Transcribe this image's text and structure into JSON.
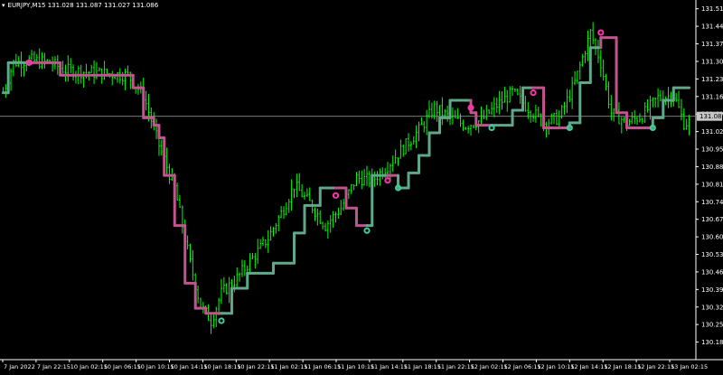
{
  "header": {
    "symbol_line": "EURJPY,M15  131.028 131.087 131.027 131.086"
  },
  "current_price_label": "131.086",
  "colors": {
    "background": "#000000",
    "bars": "#00ff00",
    "axis": "#ffffff",
    "text": "#ffffff",
    "trend_up": "#5fa88a",
    "trend_down": "#c2538f",
    "dot_up": "#3ccf9a",
    "dot_down": "#ff33aa",
    "bid_line": "#8c8c8c"
  },
  "chart_data": {
    "type": "candlestick",
    "symbol": "EURJPY",
    "timeframe": "M15",
    "ohlc_readout": {
      "open": 131.028,
      "high": 131.087,
      "low": 131.027,
      "close": 131.086
    },
    "ylim": [
      130.115,
      131.55
    ],
    "y_ticks": [
      "131.515",
      "131.445",
      "131.375",
      "131.305",
      "131.235",
      "131.165",
      "131.095",
      "131.025",
      "130.955",
      "130.885",
      "130.815",
      "130.745",
      "130.675",
      "130.605",
      "130.535",
      "130.465",
      "130.395",
      "130.325",
      "130.255",
      "130.185"
    ],
    "x_ticks": [
      "7 Jan 2022",
      "7 Jan 22:15",
      "10 Jan 02:15",
      "10 Jan 06:15",
      "10 Jan 10:15",
      "10 Jan 14:15",
      "10 Jan 18:15",
      "10 Jan 22:15",
      "11 Jan 02:15",
      "11 Jan 06:15",
      "11 Jan 10:15",
      "11 Jan 14:15",
      "11 Jan 18:15",
      "11 Jan 22:15",
      "12 Jan 02:15",
      "12 Jan 06:15",
      "12 Jan 10:15",
      "12 Jan 14:15",
      "12 Jan 18:15",
      "12 Jan 22:15",
      "13 Jan 02:15"
    ],
    "close_anchors": [
      [
        0,
        131.18
      ],
      [
        4,
        131.3
      ],
      [
        10,
        131.31
      ],
      [
        18,
        131.3
      ],
      [
        24,
        131.27
      ],
      [
        35,
        131.26
      ],
      [
        48,
        131.25
      ],
      [
        54,
        131.17
      ],
      [
        60,
        130.97
      ],
      [
        66,
        130.8
      ],
      [
        72,
        130.5
      ],
      [
        76,
        130.33
      ],
      [
        80,
        130.27
      ],
      [
        84,
        130.38
      ],
      [
        90,
        130.44
      ],
      [
        96,
        130.52
      ],
      [
        102,
        130.6
      ],
      [
        108,
        130.72
      ],
      [
        112,
        130.81
      ],
      [
        118,
        130.74
      ],
      [
        124,
        130.65
      ],
      [
        130,
        130.72
      ],
      [
        136,
        130.84
      ],
      [
        142,
        130.83
      ],
      [
        148,
        130.89
      ],
      [
        154,
        130.96
      ],
      [
        160,
        131.03
      ],
      [
        166,
        131.12
      ],
      [
        172,
        131.08
      ],
      [
        178,
        131.05
      ],
      [
        184,
        131.07
      ],
      [
        190,
        131.13
      ],
      [
        196,
        131.18
      ],
      [
        202,
        131.12
      ],
      [
        208,
        131.06
      ],
      [
        214,
        131.08
      ],
      [
        220,
        131.22
      ],
      [
        226,
        131.42
      ],
      [
        230,
        131.3
      ],
      [
        234,
        131.1
      ],
      [
        240,
        131.06
      ],
      [
        246,
        131.09
      ],
      [
        252,
        131.16
      ],
      [
        258,
        131.17
      ],
      [
        262,
        131.06
      ]
    ],
    "trend_steps": [
      {
        "from": 0,
        "to": 2,
        "level": 131.18,
        "dir": "up"
      },
      {
        "from": 2,
        "to": 10,
        "level": 131.3,
        "dir": "up"
      },
      {
        "from": 10,
        "to": 22,
        "level": 131.3,
        "dir": "down"
      },
      {
        "from": 22,
        "to": 50,
        "level": 131.25,
        "dir": "down"
      },
      {
        "from": 50,
        "to": 54,
        "level": 131.2,
        "dir": "down"
      },
      {
        "from": 54,
        "to": 58,
        "level": 131.08,
        "dir": "down"
      },
      {
        "from": 58,
        "to": 60,
        "level": 131.05,
        "dir": "down"
      },
      {
        "from": 60,
        "to": 62,
        "level": 131.0,
        "dir": "down"
      },
      {
        "from": 62,
        "to": 66,
        "level": 130.85,
        "dir": "down"
      },
      {
        "from": 66,
        "to": 70,
        "level": 130.65,
        "dir": "down"
      },
      {
        "from": 70,
        "to": 74,
        "level": 130.42,
        "dir": "down"
      },
      {
        "from": 74,
        "to": 78,
        "level": 130.32,
        "dir": "down"
      },
      {
        "from": 78,
        "to": 84,
        "level": 130.3,
        "dir": "down"
      },
      {
        "from": 84,
        "to": 88,
        "level": 130.3,
        "dir": "up"
      },
      {
        "from": 88,
        "to": 94,
        "level": 130.4,
        "dir": "up"
      },
      {
        "from": 94,
        "to": 104,
        "level": 130.46,
        "dir": "up"
      },
      {
        "from": 104,
        "to": 112,
        "level": 130.5,
        "dir": "up"
      },
      {
        "from": 112,
        "to": 116,
        "level": 130.62,
        "dir": "up"
      },
      {
        "from": 116,
        "to": 122,
        "level": 130.73,
        "dir": "up"
      },
      {
        "from": 122,
        "to": 128,
        "level": 130.8,
        "dir": "up"
      },
      {
        "from": 128,
        "to": 132,
        "level": 130.8,
        "dir": "down"
      },
      {
        "from": 132,
        "to": 136,
        "level": 130.72,
        "dir": "down"
      },
      {
        "from": 136,
        "to": 140,
        "level": 130.65,
        "dir": "down"
      },
      {
        "from": 140,
        "to": 142,
        "level": 130.65,
        "dir": "up"
      },
      {
        "from": 142,
        "to": 148,
        "level": 130.85,
        "dir": "up"
      },
      {
        "from": 148,
        "to": 152,
        "level": 130.85,
        "dir": "down"
      },
      {
        "from": 152,
        "to": 156,
        "level": 130.8,
        "dir": "up"
      },
      {
        "from": 156,
        "to": 160,
        "level": 130.86,
        "dir": "up"
      },
      {
        "from": 160,
        "to": 164,
        "level": 130.93,
        "dir": "up"
      },
      {
        "from": 164,
        "to": 168,
        "level": 131.02,
        "dir": "up"
      },
      {
        "from": 168,
        "to": 172,
        "level": 131.08,
        "dir": "up"
      },
      {
        "from": 172,
        "to": 180,
        "level": 131.15,
        "dir": "up"
      },
      {
        "from": 180,
        "to": 182,
        "level": 131.1,
        "dir": "down"
      },
      {
        "from": 182,
        "to": 188,
        "level": 131.05,
        "dir": "down"
      },
      {
        "from": 188,
        "to": 196,
        "level": 131.05,
        "dir": "up"
      },
      {
        "from": 196,
        "to": 200,
        "level": 131.11,
        "dir": "up"
      },
      {
        "from": 200,
        "to": 204,
        "level": 131.2,
        "dir": "up"
      },
      {
        "from": 204,
        "to": 208,
        "level": 131.2,
        "dir": "down"
      },
      {
        "from": 208,
        "to": 218,
        "level": 131.04,
        "dir": "down"
      },
      {
        "from": 218,
        "to": 222,
        "level": 131.06,
        "dir": "up"
      },
      {
        "from": 222,
        "to": 226,
        "level": 131.22,
        "dir": "up"
      },
      {
        "from": 226,
        "to": 230,
        "level": 131.36,
        "dir": "up"
      },
      {
        "from": 230,
        "to": 236,
        "level": 131.4,
        "dir": "down"
      },
      {
        "from": 236,
        "to": 240,
        "level": 131.1,
        "dir": "down"
      },
      {
        "from": 240,
        "to": 250,
        "level": 131.04,
        "dir": "down"
      },
      {
        "from": 250,
        "to": 254,
        "level": 131.08,
        "dir": "up"
      },
      {
        "from": 254,
        "to": 258,
        "level": 131.15,
        "dir": "up"
      },
      {
        "from": 258,
        "to": 264,
        "level": 131.2,
        "dir": "up"
      }
    ],
    "signal_dots": [
      {
        "at": 10,
        "level": 131.3,
        "dir": "down"
      },
      {
        "at": 84,
        "level": 130.27,
        "dir": "up"
      },
      {
        "at": 128,
        "level": 130.77,
        "dir": "down"
      },
      {
        "at": 140,
        "level": 130.63,
        "dir": "up"
      },
      {
        "at": 148,
        "level": 130.83,
        "dir": "down"
      },
      {
        "at": 152,
        "level": 130.8,
        "dir": "up"
      },
      {
        "at": 180,
        "level": 131.12,
        "dir": "down"
      },
      {
        "at": 188,
        "level": 131.04,
        "dir": "up"
      },
      {
        "at": 204,
        "level": 131.18,
        "dir": "down"
      },
      {
        "at": 218,
        "level": 131.04,
        "dir": "up"
      },
      {
        "at": 230,
        "level": 131.42,
        "dir": "down"
      },
      {
        "at": 250,
        "level": 131.04,
        "dir": "up"
      }
    ],
    "bid_line": 131.086,
    "bar_count": 265
  }
}
